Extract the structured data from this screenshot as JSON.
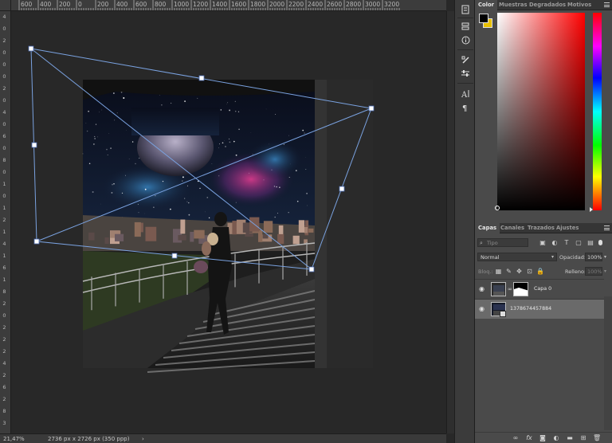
{
  "ruler_top": [
    "600",
    "400",
    "200",
    "0",
    "200",
    "400",
    "600",
    "800",
    "1000",
    "1200",
    "1400",
    "1600",
    "1800",
    "2000",
    "2200",
    "2400",
    "2600",
    "2800",
    "3000",
    "3200"
  ],
  "ruler_left": [
    "4",
    "0",
    "2",
    "0",
    "0",
    "0",
    "2",
    "0",
    "4",
    "0",
    "6",
    "0",
    "8",
    "0",
    "1",
    "0",
    "1",
    "2",
    "1",
    "4",
    "1",
    "6",
    "1",
    "8",
    "2",
    "0",
    "2",
    "2",
    "2",
    "4",
    "2",
    "6",
    "2",
    "8",
    "3"
  ],
  "status": {
    "zoom": "21,47%",
    "doc_info": "2736 px x 2726 px (350 ppp)",
    "arrow": "›"
  },
  "color_panel": {
    "tabs": [
      "Color",
      "Muestras",
      "Degradados",
      "Motivos"
    ],
    "foreground": "#000000",
    "background": "#e8c000",
    "hue": "#ff0000"
  },
  "layers_panel": {
    "tabs": [
      "Capas",
      "Canales",
      "Trazados",
      "Ajustes"
    ],
    "search_placeholder": "Tipo",
    "blend_mode": "Normal",
    "opacity_label": "Opacidad:",
    "opacity_value": "100%",
    "lock_label": "Bloq.:",
    "fill_label": "Relleno:",
    "fill_value": "100%",
    "layers": [
      {
        "name": "Capa 0",
        "selected": false
      },
      {
        "name": "1378674457884",
        "selected": true
      }
    ]
  },
  "tools": [
    "history-icon",
    "properties-icon",
    "info-icon",
    "brush-preset-icon",
    "brush-icon",
    "sliders-icon",
    "character-icon",
    "paragraph-icon"
  ]
}
